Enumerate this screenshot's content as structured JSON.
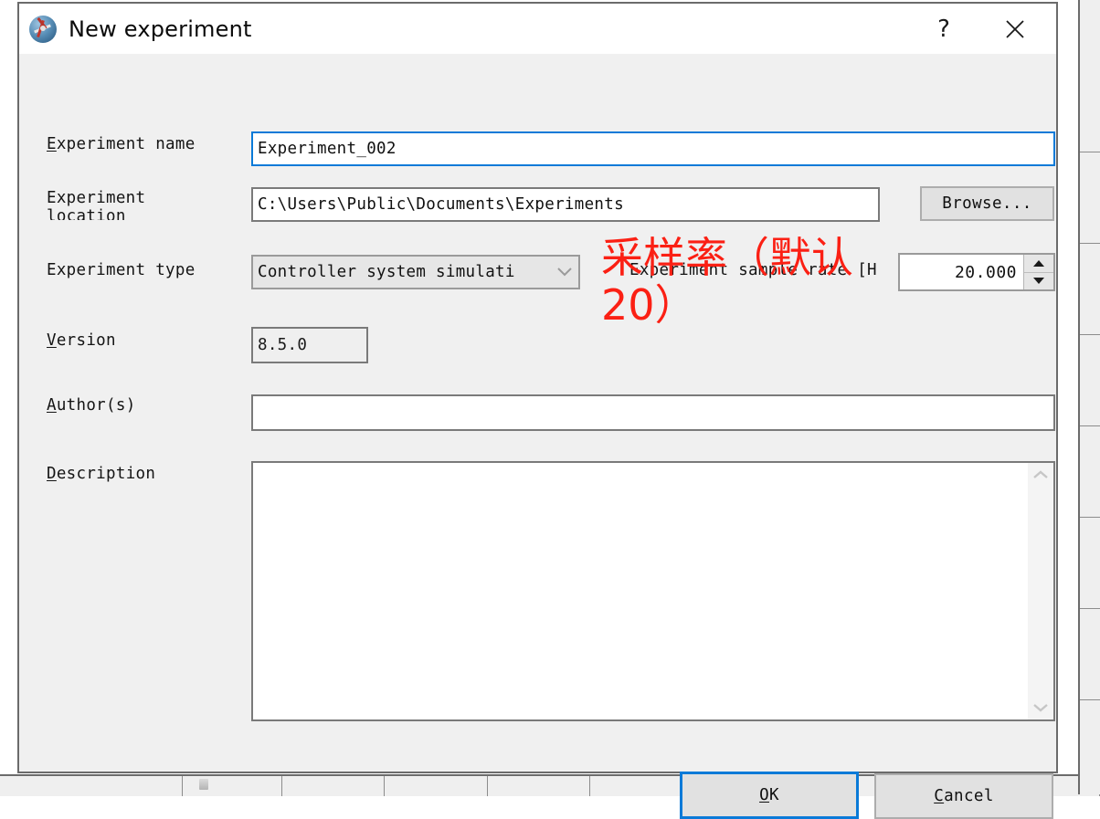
{
  "window": {
    "title": "New experiment",
    "icon": "experiment-globe-icon",
    "help_label": "?",
    "close_label": "✕"
  },
  "form": {
    "experiment_name": {
      "label_mnemonic": "E",
      "label_rest": "xperiment name",
      "value": "Experiment_002",
      "focused": true
    },
    "experiment_location": {
      "label_line1": "Experiment",
      "label_line2": "location",
      "value": "C:\\Users\\Public\\Documents\\Experiments",
      "browse_label_mnemonic": "",
      "browse_label": "Browse..."
    },
    "experiment_type": {
      "label": "Experiment type",
      "value": "Controller system simulati",
      "options": [
        "Controller system simulati"
      ]
    },
    "sample_rate": {
      "label": "Experiment sample rate [H",
      "label_full": "Experiment sample rate [Hz]",
      "value": "20.000"
    },
    "version": {
      "label_mnemonic": "V",
      "label_rest": "ersion",
      "value": "8.5.0"
    },
    "authors": {
      "label_mnemonic": "A",
      "label_rest": "uthor(s)",
      "value": ""
    },
    "description": {
      "label_mnemonic": "D",
      "label_rest": "escription",
      "value": ""
    }
  },
  "buttons": {
    "ok": {
      "mnemonic": "O",
      "rest": "K"
    },
    "cancel": {
      "mnemonic": "C",
      "rest": "ancel"
    }
  },
  "annotation": {
    "text": "采样率（默认\n20）",
    "color": "#fb2014"
  },
  "colors": {
    "dialog_background": "#f0f0f0",
    "titlebar_background": "#ffffff",
    "field_border": "#7a7a7a",
    "focus_blue": "#0a7ad8",
    "button_face": "#e1e1e1",
    "annotation_red": "#fb2014"
  }
}
